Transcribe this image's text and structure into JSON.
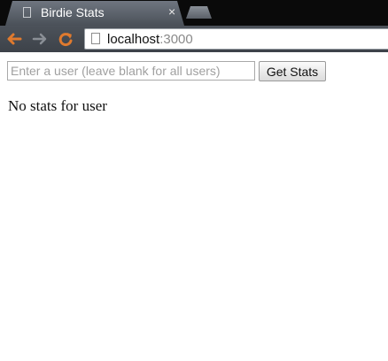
{
  "browser": {
    "tab": {
      "title": "Birdie Stats",
      "close_glyph": "×",
      "favicon": "page-icon"
    },
    "new_tab": {
      "icon": "new-tab-icon"
    },
    "nav": {
      "back_glyph": "🡐",
      "forward_glyph": "🡒",
      "reload_glyph": "↻"
    },
    "address": {
      "host": "localhost",
      "port": ":3000"
    }
  },
  "form": {
    "user_placeholder": "Enter a user (leave blank for all users)",
    "user_value": "",
    "submit_label": "Get Stats"
  },
  "result": {
    "message": "No stats for user"
  },
  "colors": {
    "accent": "#e07a2e",
    "chrome_dark": "#0a0a0a",
    "tab_active": "#5b6169"
  }
}
